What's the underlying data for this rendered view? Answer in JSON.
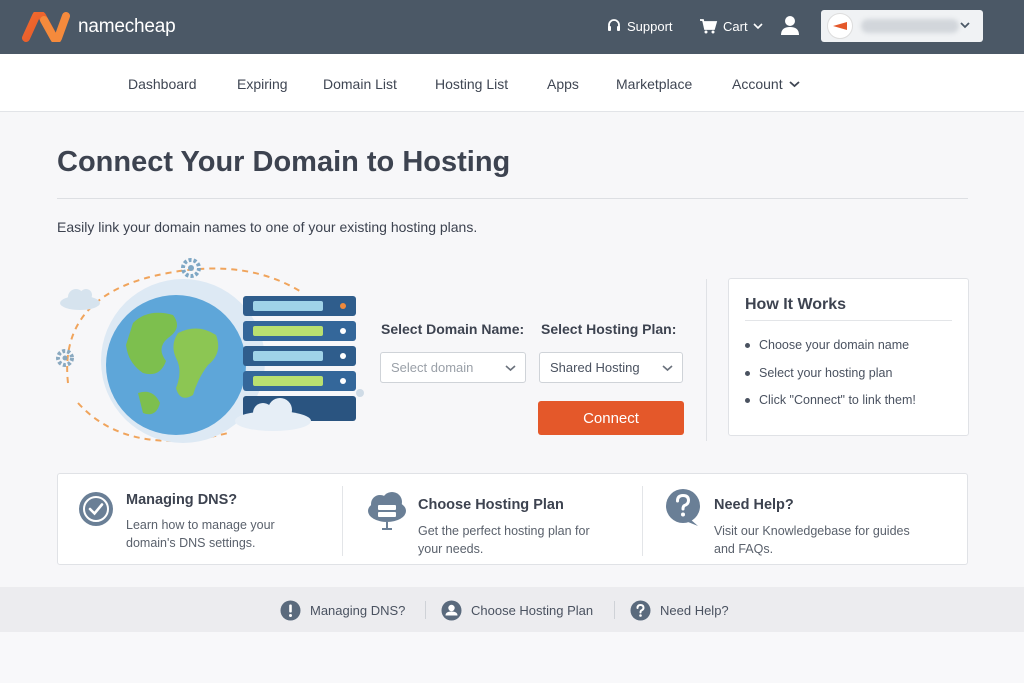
{
  "header": {
    "brand": "namecheap",
    "support_label": "Support",
    "cart_label": "Cart"
  },
  "nav": {
    "items": [
      "Dashboard",
      "Expiring",
      "Domain List",
      "Hosting List",
      "Apps",
      "Marketplace",
      "Account"
    ]
  },
  "main": {
    "title": "Connect Your Domain to Hosting",
    "subtitle": "Easily link your domain names to one of your existing hosting plans.",
    "domain_label": "Select Domain Name:",
    "domain_placeholder": "Select domain",
    "plan_label": "Select Hosting Plan:",
    "plan_value": "Shared Hosting",
    "connect_label": "Connect"
  },
  "how_it_works": {
    "title": "How It Works",
    "steps": [
      "Choose your domain name",
      "Select your hosting plan",
      "Click \"Connect\" to link them!"
    ]
  },
  "cards": [
    {
      "title": "Managing DNS?",
      "desc1": "Learn how to manage your",
      "desc2": "domain's DNS settings.",
      "icon": "check-circle-icon"
    },
    {
      "title": "Choose Hosting Plan",
      "desc1": "Get the perfect hosting plan for",
      "desc2": "your needs.",
      "icon": "cloud-server-icon"
    },
    {
      "title": "Need Help?",
      "desc1": "Visit our Knowledgebase for guides",
      "desc2": "and FAQs.",
      "icon": "question-bubble-icon"
    }
  ],
  "footer": {
    "items": [
      "Managing DNS?",
      "Choose Hosting Plan",
      "Need Help?"
    ]
  },
  "colors": {
    "topbar": "#4b5866",
    "brand_orange": "#e4582a",
    "text_dark": "#3d4350"
  }
}
